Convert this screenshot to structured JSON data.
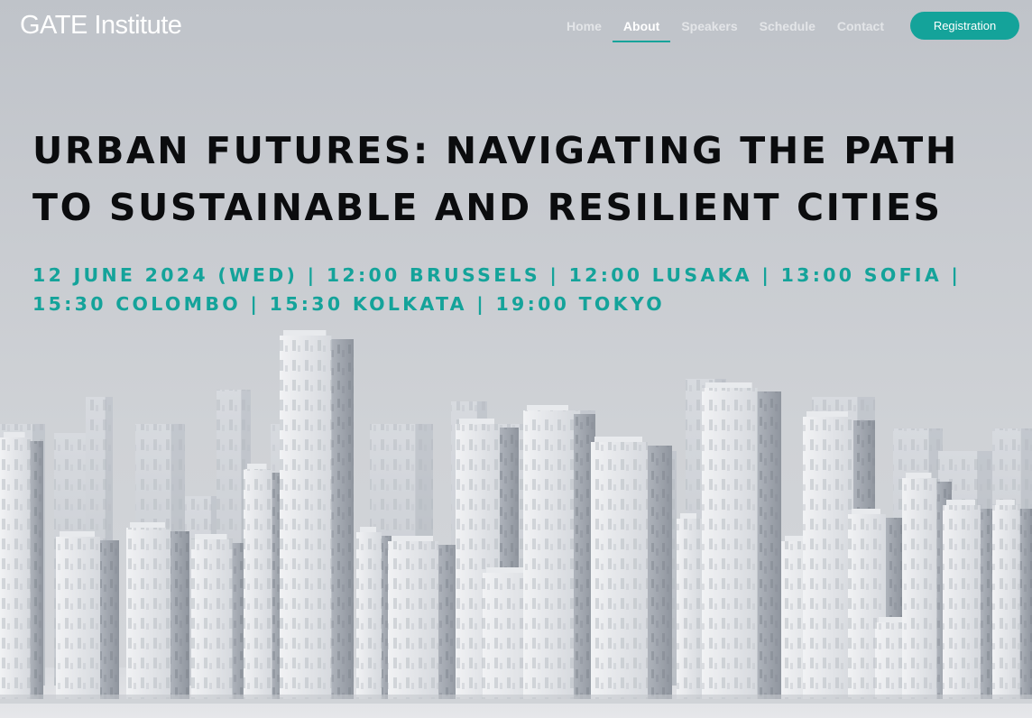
{
  "nav": {
    "logo": "GATE Institute",
    "links": [
      {
        "label": "Home",
        "active": false
      },
      {
        "label": "About",
        "active": true
      },
      {
        "label": "Speakers",
        "active": false
      },
      {
        "label": "Schedule",
        "active": false
      },
      {
        "label": "Contact",
        "active": false
      }
    ],
    "registration_label": "Registration"
  },
  "hero": {
    "title": "URBAN FUTURES: NAVIGATING THE PATH TO SUSTAINABLE AND RESILIENT CITIES",
    "subtitle": "12 JUNE 2024 (WED) | 12:00 BRUSSELS | 12:00 LUSAKA | 13:00 SOFIA | 15:30 COLOMBO | 15:30 KOLKATA | 19:00 TOKYO",
    "background_image": "white-model-city-skyline"
  },
  "colors": {
    "accent": "#14a39a",
    "title": "#0b0c0e",
    "background": "#c9ccd1"
  }
}
